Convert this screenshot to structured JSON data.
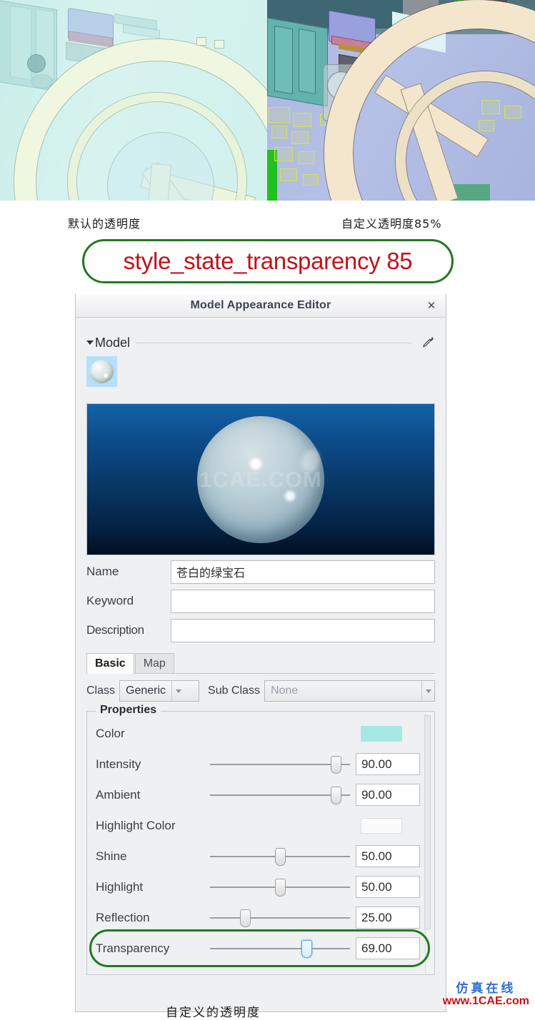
{
  "comparison": {
    "left_caption": "默认的透明度",
    "right_caption": "自定义透明度85%",
    "left_pane_name": "default-transparency-view",
    "right_pane_name": "custom-transparency-view"
  },
  "banner": {
    "text": "style_state_transparency 85",
    "text_color": "#c0121a",
    "border_color": "#1f7a1f"
  },
  "dialog": {
    "title": "Model Appearance Editor",
    "close_label": "✕",
    "group": {
      "label": "Model",
      "eyedropper_name": "eyedropper-icon"
    },
    "preview": {
      "watermark": "1CAE.COM"
    },
    "fields": [
      {
        "label": "Name",
        "value": "苍白的绿宝石",
        "placeholder": ""
      },
      {
        "label": "Keyword",
        "value": "",
        "placeholder": ""
      },
      {
        "label": "Description",
        "value": "",
        "placeholder": ""
      }
    ],
    "tabs": [
      {
        "label": "Basic",
        "active": true
      },
      {
        "label": "Map",
        "active": false
      }
    ],
    "class_row": {
      "class_label": "Class",
      "class_value": "Generic",
      "sub_class_label": "Sub Class",
      "sub_class_value": "None"
    },
    "properties": {
      "legend": "Properties",
      "color": {
        "label": "Color",
        "swatch": "#a6e8e2"
      },
      "highlight_color": {
        "label": "Highlight Color",
        "swatch": "#fbfbfb"
      },
      "rows": [
        {
          "label": "Intensity",
          "value": "90.00",
          "percent": 90
        },
        {
          "label": "Ambient",
          "value": "90.00",
          "percent": 90
        },
        {
          "label": "Shine",
          "value": "50.00",
          "percent": 50
        },
        {
          "label": "Highlight",
          "value": "50.00",
          "percent": 50
        },
        {
          "label": "Reflection",
          "value": "25.00",
          "percent": 25
        },
        {
          "label": "Transparency",
          "value": "69.00",
          "percent": 69
        }
      ]
    }
  },
  "watermark": {
    "cn": "仿真在线",
    "url": "www.1CAE.com"
  },
  "bottom_note": "自定义的透明度"
}
